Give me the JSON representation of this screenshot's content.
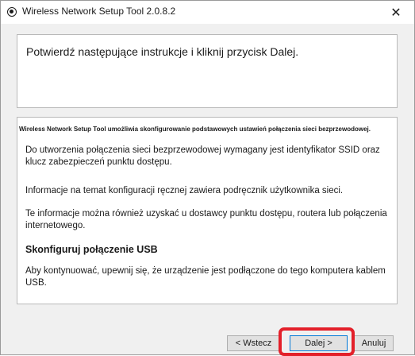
{
  "window": {
    "title": "Wireless Network Setup Tool 2.0.8.2",
    "close_glyph": "✕"
  },
  "header": {
    "instruction": "Potwierdź następujące instrukcje i kliknij przycisk Dalej."
  },
  "content": {
    "intro_bold": "Wireless Network Setup Tool umożliwia skonfigurowanie podstawowych ustawień połączenia sieci bezprzewodowej.",
    "paragraph_1": "Do utworzenia połączenia sieci bezprzewodowej wymagany jest identyfikator SSID oraz klucz zabezpieczeń punktu dostępu.",
    "paragraph_2": "Informacje na temat konfiguracji ręcznej zawiera podręcznik użytkownika sieci.",
    "paragraph_3": "Te informacje można również uzyskać u dostawcy punktu dostępu, routera lub połączenia internetowego.",
    "usb_heading": "Skonfiguruj połączenie USB",
    "paragraph_4": "Aby kontynuować, upewnij się, że urządzenie jest podłączone do tego komputera kablem USB."
  },
  "buttons": {
    "back": "< Wstecz",
    "next": "Dalej >",
    "cancel": "Anuluj"
  },
  "colors": {
    "highlight": "#e3202a",
    "focus_border": "#0078d7"
  }
}
